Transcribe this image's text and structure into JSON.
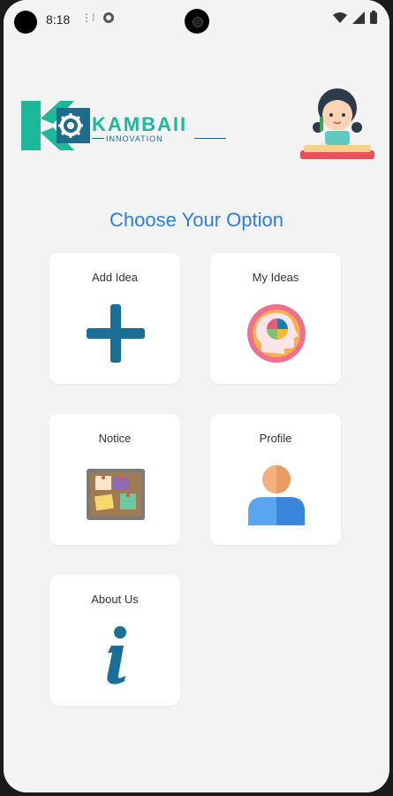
{
  "status_bar": {
    "time": "8:18",
    "icons": [
      "signal-dots-icon",
      "notification-icon",
      "wifi-icon",
      "cell-signal-icon",
      "battery-icon"
    ]
  },
  "header": {
    "logo_title": "KAMBAII",
    "logo_subtitle": "INNOVATION"
  },
  "main": {
    "title": "Choose Your Option",
    "options": [
      {
        "label": "Add Idea",
        "icon": "plus-icon"
      },
      {
        "label": "My Ideas",
        "icon": "head-pie-chart-icon"
      },
      {
        "label": "Notice",
        "icon": "notice-board-icon"
      },
      {
        "label": "Profile",
        "icon": "user-profile-icon"
      },
      {
        "label": "About Us",
        "icon": "info-icon"
      }
    ]
  },
  "colors": {
    "accent": "#2b7fe0",
    "brand_teal": "#1db89a",
    "brand_blue": "#1e6b8c",
    "background": "#f3f3f3"
  }
}
